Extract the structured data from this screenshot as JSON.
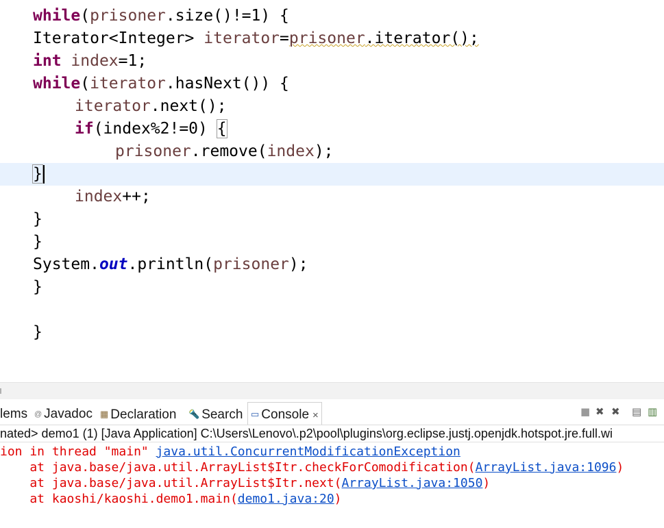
{
  "editor": {
    "lines": {
      "l1": {
        "kw": "while",
        "open": "(",
        "var": "prisoner",
        "rest": ".size()!=1) {"
      },
      "l2": {
        "type": "Iterator<Integer> ",
        "var": "iterator",
        "eq": "=",
        "var2": "prisoner",
        "rest": ".iterator();"
      },
      "l3": {
        "kw": "int",
        "sp": " ",
        "var": "index",
        "rest": "=1;"
      },
      "l4": {
        "kw": "while",
        "open": "(",
        "var": "iterator",
        "rest": ".hasNext()) {"
      },
      "l5": {
        "var": "iterator",
        "rest": ".next();"
      },
      "l6": {
        "kw": "if",
        "rest": "(index%2!=0) ",
        "brace": "{"
      },
      "l7": {
        "var": "prisoner",
        "mid": ".remove(",
        "var2": "index",
        "rest": ");"
      },
      "l8": {
        "text": "}"
      },
      "l9": {
        "var": "index",
        "rest": "++;"
      },
      "l10": {
        "text": "}"
      },
      "l11": {
        "text": "}"
      },
      "l12": {
        "cls": "System.",
        "fld": "out",
        "mid": ".println(",
        "var": "prisoner",
        "rest": ");"
      },
      "l13": {
        "text": "}"
      },
      "l14": {
        "text": "}"
      }
    }
  },
  "tabs": {
    "problems": "lems",
    "javadoc": "Javadoc",
    "declaration": "Declaration",
    "search": "Search",
    "console": "Console",
    "close": "×"
  },
  "icons": {
    "javadoc": "@",
    "declaration": "▦",
    "search": "🔦",
    "console": "▭",
    "stop": "■",
    "remove": "✖",
    "remove_all": "✖",
    "scroll_lock": "▤",
    "pin": "▥"
  },
  "console": {
    "header": "nated> demo1 (1) [Java Application] C:\\Users\\Lenovo\\.p2\\pool\\plugins\\org.eclipse.justj.openjdk.hotspot.jre.full.wi",
    "exception_prefix": "ion in thread \"main\" ",
    "exception_link": "java.util.ConcurrentModificationException",
    "frames": [
      {
        "at": "    at java.base/java.util.ArrayList$Itr.checkForComodification(",
        "link": "ArrayList.java:1096",
        "end": ")"
      },
      {
        "at": "    at java.base/java.util.ArrayList$Itr.next(",
        "link": "ArrayList.java:1050",
        "end": ")"
      },
      {
        "at": "    at kaoshi/kaoshi.demo1.main(",
        "link": "demo1.java:20",
        "end": ")"
      }
    ]
  },
  "colors": {
    "keyword": "#7f0055",
    "variable": "#6a3e3e",
    "field": "#0000c0",
    "error": "#e00000",
    "link": "#0b4ec7",
    "current_line": "#e8f2fe"
  }
}
